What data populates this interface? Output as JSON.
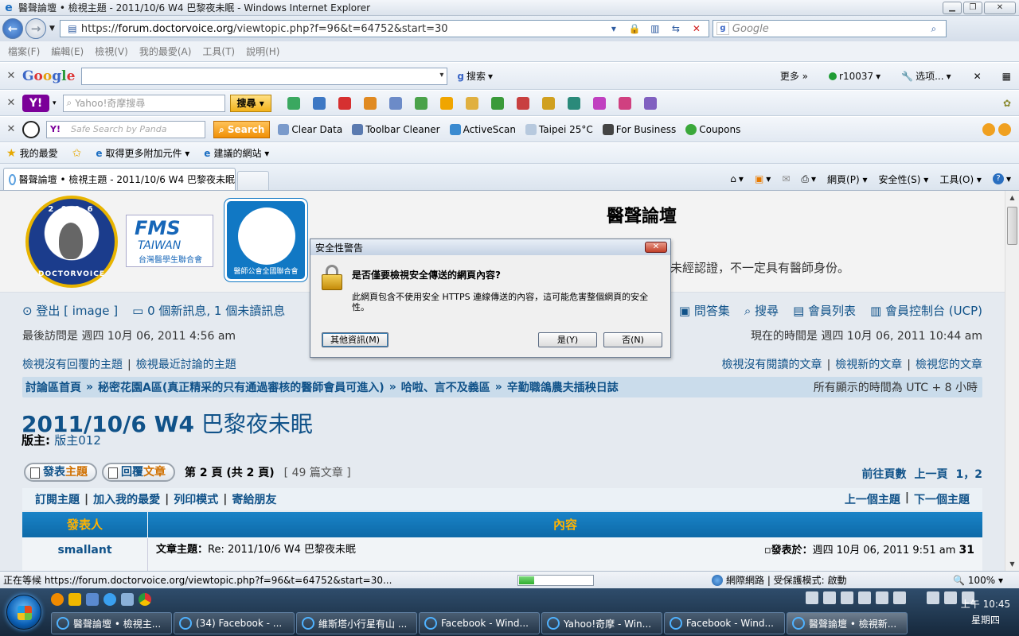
{
  "window": {
    "title": "醫聲論壇 • 檢視主題 - 2011/10/6 W4 巴黎夜未眠 - Windows Internet Explorer",
    "url_prefix": "https://",
    "url_domain": "forum.doctorvoice.org",
    "url_path": "/viewtopic.php?f=96&t=64752&start=30",
    "search_placeholder": "Google"
  },
  "menu": [
    "檔案(F)",
    "編輯(E)",
    "檢視(V)",
    "我的最愛(A)",
    "工具(T)",
    "說明(H)"
  ],
  "google_toolbar": {
    "logo": [
      "G",
      "o",
      "o",
      "g",
      "l",
      "e"
    ],
    "search_label": "搜索",
    "more": "更多 »",
    "user": "r10037",
    "options": "选项..."
  },
  "yahoo_toolbar": {
    "logo": "Y!",
    "search_placeholder": "Yahoo!奇摩搜尋",
    "search_button": "搜尋"
  },
  "panda_toolbar": {
    "search_placeholder": "Safe Search by Panda",
    "search_button": "Search",
    "items": [
      "Clear Data",
      "Toolbar Cleaner",
      "ActiveScan",
      "Taipei 25°C",
      "For Business",
      "Coupons"
    ]
  },
  "favorites_bar": {
    "favorites": "我的最愛",
    "addons": "取得更多附加元件 ▾",
    "suggested": "建議的網站 ▾"
  },
  "tab": {
    "label": "醫聲論壇 • 檢視主題 - 2011/10/6 W4 巴黎夜未眠"
  },
  "command_bar": [
    "網頁(P) ▾",
    "安全性(S) ▾",
    "工具(O) ▾"
  ],
  "site": {
    "logo_year": "2 0 0 6",
    "logo_name": "DOCTORVOICE",
    "fms_big": "FMS",
    "fms_mid": "TAIWAN",
    "fms_small": "台灣醫學生聯合會",
    "tma_caption": "醫師公會全國聯合會",
    "title": "醫聲論壇",
    "desc": "未經認證，不一定具有醫師身份。"
  },
  "nav": {
    "logout": "登出 [ image ]",
    "messages": "0 個新訊息, 1 個未讀訊息",
    "faq": "問答集",
    "search": "搜尋",
    "members": "會員列表",
    "ucp": "會員控制台 (UCP)",
    "last_visit": "最後訪問是 週四 10月 06, 2011 4:56 am",
    "current_time": "現在的時間是 週四 10月 06, 2011 10:44 am",
    "unanswered": "檢視沒有回覆的主題",
    "active": "檢視最近討論的主題",
    "unread": "檢視沒有閱讀的文章",
    "new_posts": "檢視新的文章",
    "your_posts": "檢視您的文章"
  },
  "breadcrumb": {
    "items": [
      "討論區首頁",
      "秘密花園A區(真正精采的只有通過審核的醫師會員可進入)",
      "哈啦、言不及義區",
      "辛勤職鴿農夫插秧日誌"
    ],
    "timezone": "所有顯示的時間為 UTC + 8 小時"
  },
  "topic": {
    "title_en": "2011/10/6 W4",
    "title_zh": "巴黎夜未眠",
    "moderator_label": "版主:",
    "moderator": "版主012"
  },
  "actions": {
    "post_a": "發表",
    "post_b": "主題",
    "reply_a": "回覆",
    "reply_b": "文章",
    "page_info": "第 2 頁 (共 2 頁)",
    "post_count": "[ 49 篇文章 ]",
    "goto": "前往頁數",
    "prev": "上一頁",
    "pages": "1，2"
  },
  "options": {
    "left": [
      "訂閱主題",
      "加入我的最愛",
      "列印模式",
      "寄給朋友"
    ],
    "right": [
      "上一個主題",
      "下一個主題"
    ]
  },
  "table": {
    "col_author": "發表人",
    "col_content": "內容",
    "rows": [
      {
        "author": "smallant",
        "subject_label": "文章主題：",
        "subject": "Re: 2011/10/6 W4 巴黎夜未眠",
        "posted_label": "發表於：",
        "posted": "週四 10月 06, 2011 9:51 am",
        "num": "31"
      }
    ]
  },
  "dialog": {
    "title": "安全性警告",
    "question": "是否僅要檢視安全傳送的網頁內容?",
    "message": "此網頁包含不使用安全 HTTPS 連線傳送的內容，這可能危害整個網頁的安全性。",
    "more_info": "其他資訊(M)",
    "yes": "是(Y)",
    "no": "否(N)"
  },
  "status": {
    "text": "正在等候 https://forum.doctorvoice.org/viewtopic.php?f=96&t=64752&start=30...",
    "progress": 0.2,
    "zone": "網際網路 | 受保護模式: 啟動",
    "zoom": "100%"
  },
  "taskbar": {
    "tasks": [
      "醫聲論壇 • 檢視主...",
      "(34) Facebook - ...",
      "維斯塔小行星有山 ...",
      "Facebook - Wind...",
      "Yahoo!奇摩 - Win...",
      "Facebook - Wind...",
      "醫聲論壇 • 檢視新..."
    ],
    "time": "上午 10:45",
    "day": "星期四"
  }
}
